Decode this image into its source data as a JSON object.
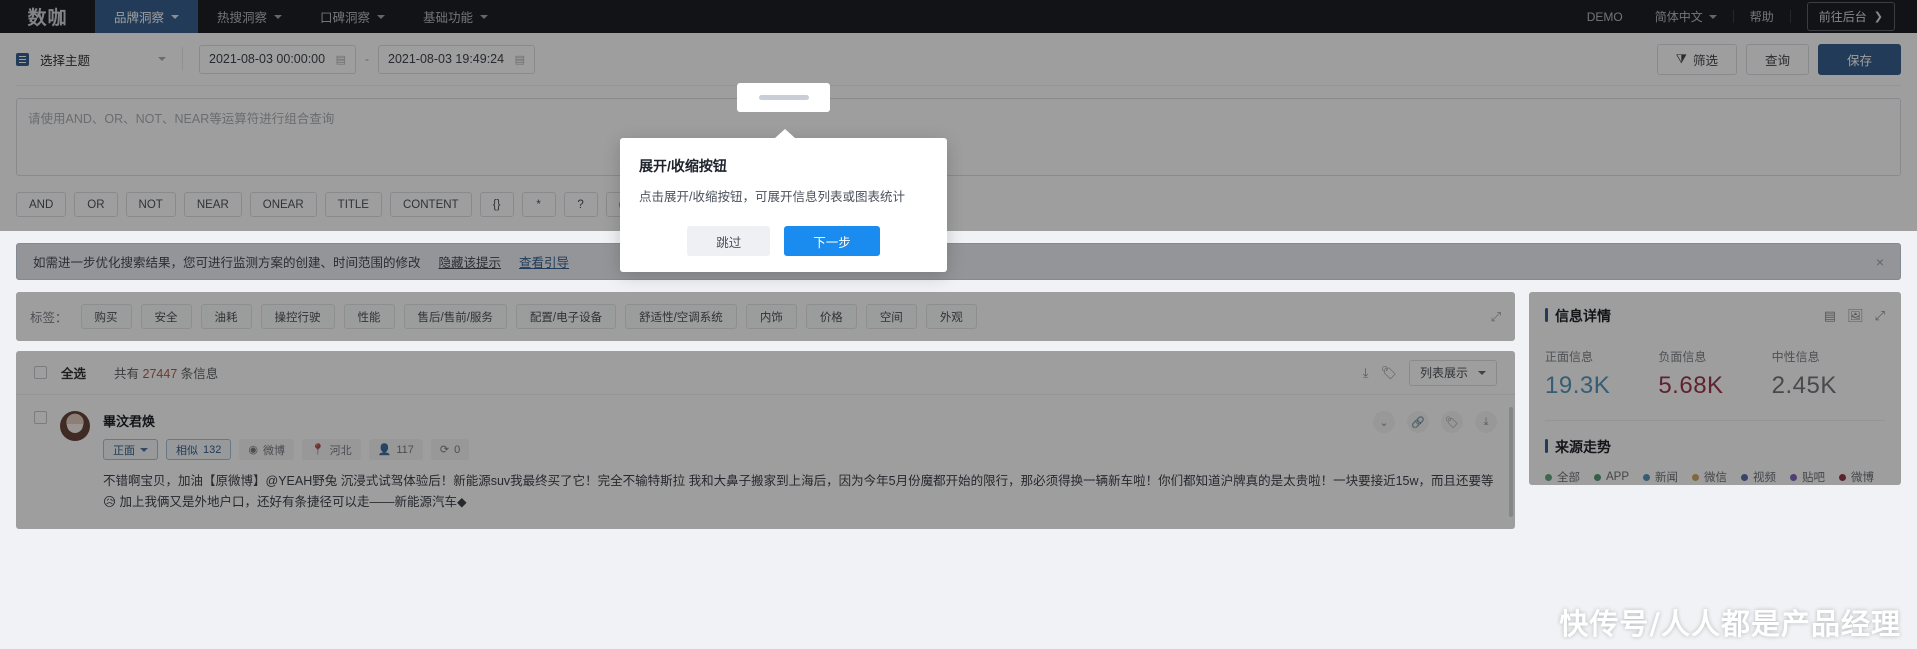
{
  "navbar": {
    "logo": "数咖",
    "items": [
      {
        "label": "品牌洞察",
        "active": true
      },
      {
        "label": "热搜洞察",
        "active": false
      },
      {
        "label": "口碑洞察",
        "active": false
      },
      {
        "label": "基础功能",
        "active": false
      }
    ],
    "demo": "DEMO",
    "language": "简体中文",
    "help": "帮助",
    "backend": "前往后台"
  },
  "search": {
    "topic_placeholder": "选择主题",
    "date_start": "2021-08-03 00:00:00",
    "date_sep": "-",
    "date_end": "2021-08-03 19:49:24",
    "filter_label": "筛选",
    "query_label": "查询",
    "save_label": "保存",
    "query_placeholder": "请使用AND、OR、NOT、NEAR等运算符进行组合查询",
    "query_value": "",
    "operators": [
      "AND",
      "OR",
      "NOT",
      "NEAR",
      "ONEAR",
      "TITLE",
      "CONTENT",
      "{}",
      "*",
      "?",
      "()",
      "\"\""
    ],
    "help_icon": "?"
  },
  "notice": {
    "text": "如需进一步优化搜索结果，您可进行监测方案的创建、时间范围的修改",
    "hide_link": "隐藏该提示",
    "guide_link": "查看引导",
    "close": "×"
  },
  "tags": {
    "label": "标签：",
    "items": [
      "购买",
      "安全",
      "油耗",
      "操控行驶",
      "性能",
      "售后/售前/服务",
      "配置/电子设备",
      "舒适性/空调系统",
      "内饰",
      "价格",
      "空间",
      "外观"
    ]
  },
  "list": {
    "select_all": "全选",
    "count_prefix": "共有",
    "count": "27447",
    "count_suffix": "条信息",
    "view_mode": "列表展示",
    "post": {
      "name": "畢汶君焕",
      "sentiment": "正面",
      "similar_label": "相似",
      "similar_count": "132",
      "source": "微博",
      "region": "河北",
      "reads": "117",
      "reposts": "0",
      "text": "不错啊宝贝，加油【原微博】@YEAH野兔 沉浸式试驾体验后！新能源suv我最终买了它！完全不输特斯拉 我和大鼻子搬家到上海后，因为今年5月份魔都开始的限行，那必须得换一辆新车啦！你们都知道沪牌真的是太贵啦！一块要接近15w，而且还要等😥 加上我俩又是外地户口，还好有条捷径可以走——新能源汽车◆"
    }
  },
  "rightPanel": {
    "title": "信息详情",
    "stats": [
      {
        "label": "正面信息",
        "value": "19.3K",
        "color": "#2a9fe0"
      },
      {
        "label": "负面信息",
        "value": "5.68K",
        "color": "#d6274c"
      },
      {
        "label": "中性信息",
        "value": "2.45K",
        "color": "#6f7683"
      }
    ],
    "trend_title": "来源走势",
    "legend": [
      {
        "label": "全部",
        "color": "#3cb371"
      },
      {
        "label": "APP",
        "color": "#2aa86a"
      },
      {
        "label": "新闻",
        "color": "#2a9fe0"
      },
      {
        "label": "微信",
        "color": "#f0a030"
      },
      {
        "label": "视频",
        "color": "#4a6fe0"
      },
      {
        "label": "贴吧",
        "color": "#8b5cf6"
      },
      {
        "label": "微博",
        "color": "#d6274c"
      }
    ]
  },
  "tour": {
    "title": "展开/收缩按钮",
    "desc": "点击展开/收缩按钮，可展开信息列表或图表统计",
    "skip": "跳过",
    "next": "下一步"
  },
  "watermark": "快传号/人人都是产品经理"
}
